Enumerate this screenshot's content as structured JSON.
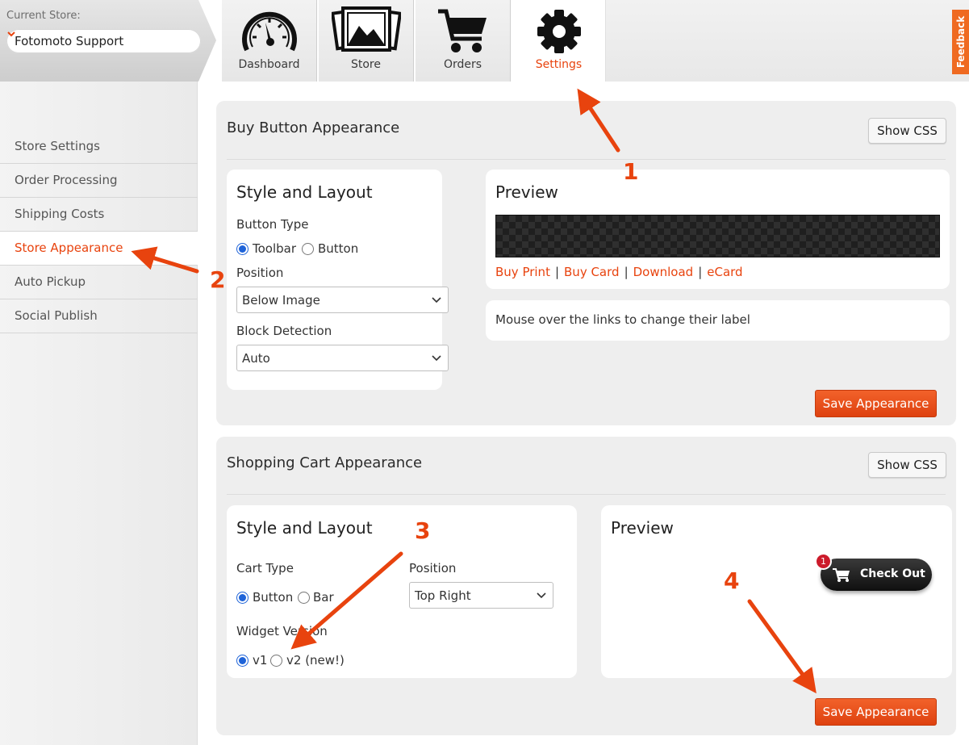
{
  "store": {
    "caption": "Current Store:",
    "selected": "Fotomoto Support"
  },
  "tabs": [
    {
      "label": "Dashboard",
      "icon": "gauge-icon"
    },
    {
      "label": "Store",
      "icon": "photos-icon"
    },
    {
      "label": "Orders",
      "icon": "cart-icon"
    },
    {
      "label": "Settings",
      "icon": "gear-icon",
      "active": true
    }
  ],
  "feedback_label": "Feedback",
  "sidebar": {
    "items": [
      {
        "label": "Store Settings"
      },
      {
        "label": "Order Processing"
      },
      {
        "label": "Shipping Costs"
      },
      {
        "label": "Store Appearance",
        "active": true
      },
      {
        "label": "Auto Pickup"
      },
      {
        "label": "Social Publish"
      }
    ]
  },
  "buy_button": {
    "title": "Buy Button Appearance",
    "show_css": "Show CSS",
    "style_title": "Style and Layout",
    "button_type_label": "Button Type",
    "button_type_options": [
      "Toolbar",
      "Button"
    ],
    "button_type_selected": "Toolbar",
    "position_label": "Position",
    "position_value": "Below Image",
    "block_label": "Block Detection",
    "block_value": "Auto",
    "preview_title": "Preview",
    "links": [
      "Buy Print",
      "Buy Card",
      "Download",
      "eCard"
    ],
    "link_separator": "|",
    "hint": "Mouse over the links to change their label",
    "save": "Save Appearance"
  },
  "cart": {
    "title": "Shopping Cart Appearance",
    "show_css": "Show CSS",
    "style_title": "Style and Layout",
    "cart_type_label": "Cart Type",
    "cart_type_options": [
      "Button",
      "Bar"
    ],
    "cart_type_selected": "Button",
    "position_label": "Position",
    "position_value": "Top Right",
    "widget_label": "Widget Version",
    "widget_options": [
      "v1",
      "v2 (new!)"
    ],
    "widget_selected": "v1",
    "preview_title": "Preview",
    "checkout_label": "Check Out",
    "badge_count": "1",
    "save": "Save Appearance"
  },
  "annotations": [
    "1",
    "2",
    "3",
    "4"
  ],
  "colors": {
    "accent": "#e8430e",
    "annotation": "#e8430e",
    "radio": "#1e63d8"
  }
}
